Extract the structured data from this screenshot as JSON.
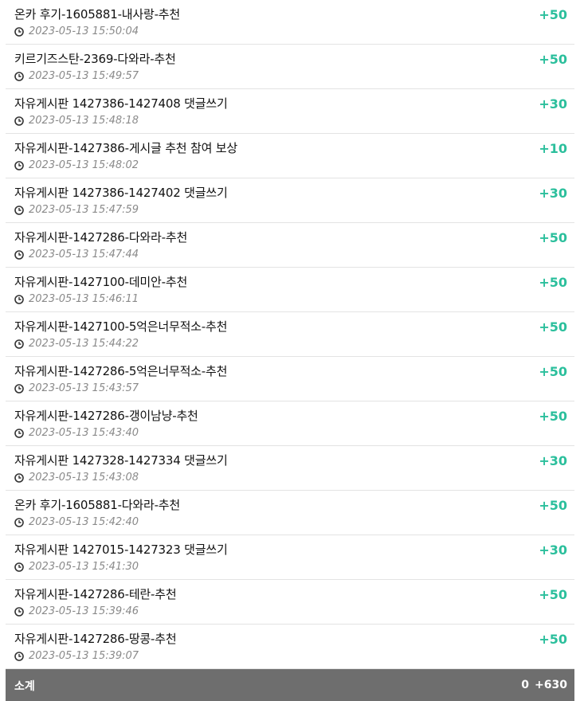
{
  "accent_color": "#2bbf9c",
  "summary_bg_color": "#6e6e6e",
  "items": [
    {
      "title": "온카 후기-1605881-내사랑-추천",
      "datetime": "2023-05-13 15:50:04",
      "points": "+50"
    },
    {
      "title": "키르기즈스탄-2369-다와라-추천",
      "datetime": "2023-05-13 15:49:57",
      "points": "+50"
    },
    {
      "title": "자유게시판 1427386-1427408 댓글쓰기",
      "datetime": "2023-05-13 15:48:18",
      "points": "+30"
    },
    {
      "title": "자유게시판-1427386-게시글 추천 참여 보상",
      "datetime": "2023-05-13 15:48:02",
      "points": "+10"
    },
    {
      "title": "자유게시판 1427386-1427402 댓글쓰기",
      "datetime": "2023-05-13 15:47:59",
      "points": "+30"
    },
    {
      "title": "자유게시판-1427286-다와라-추천",
      "datetime": "2023-05-13 15:47:44",
      "points": "+50"
    },
    {
      "title": "자유게시판-1427100-데미안-추천",
      "datetime": "2023-05-13 15:46:11",
      "points": "+50"
    },
    {
      "title": "자유게시판-1427100-5억은너무적소-추천",
      "datetime": "2023-05-13 15:44:22",
      "points": "+50"
    },
    {
      "title": "자유게시판-1427286-5억은너무적소-추천",
      "datetime": "2023-05-13 15:43:57",
      "points": "+50"
    },
    {
      "title": "자유게시판-1427286-갱이남냥-추천",
      "datetime": "2023-05-13 15:43:40",
      "points": "+50"
    },
    {
      "title": "자유게시판 1427328-1427334 댓글쓰기",
      "datetime": "2023-05-13 15:43:08",
      "points": "+30"
    },
    {
      "title": "온카 후기-1605881-다와라-추천",
      "datetime": "2023-05-13 15:42:40",
      "points": "+50"
    },
    {
      "title": "자유게시판 1427015-1427323 댓글쓰기",
      "datetime": "2023-05-13 15:41:30",
      "points": "+30"
    },
    {
      "title": "자유게시판-1427286-테란-추천",
      "datetime": "2023-05-13 15:39:46",
      "points": "+50"
    },
    {
      "title": "자유게시판-1427286-땅콩-추천",
      "datetime": "2023-05-13 15:39:07",
      "points": "+50"
    }
  ],
  "summary": {
    "label": "소계",
    "value_a": "0",
    "value_b": "+630"
  },
  "icons": {
    "time": "clock-icon"
  }
}
